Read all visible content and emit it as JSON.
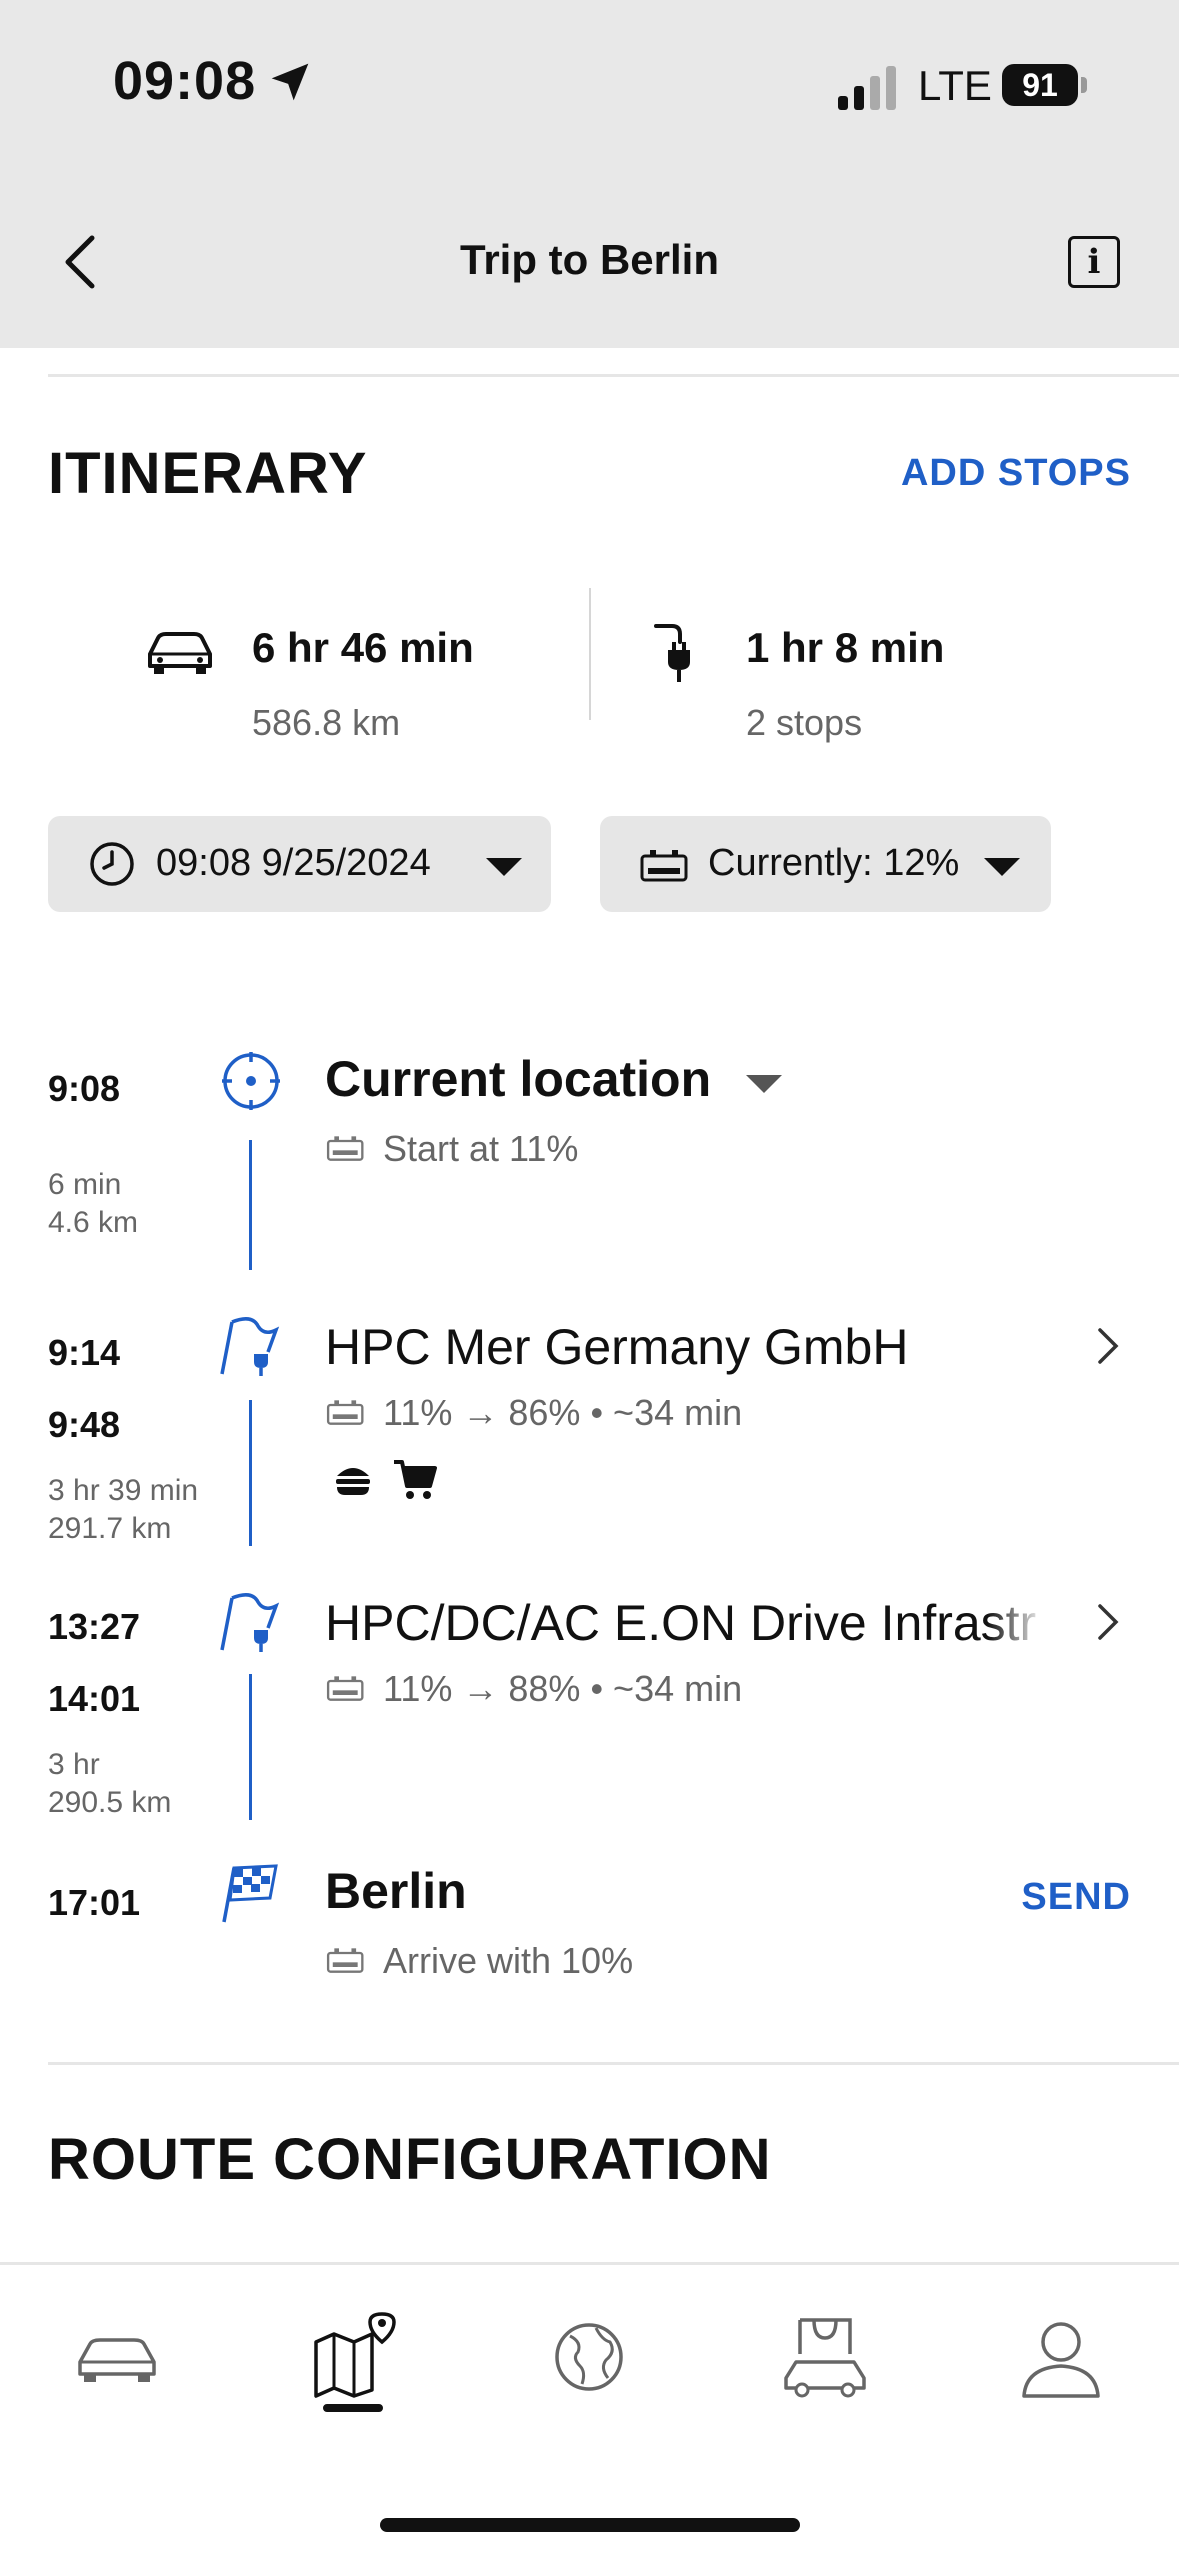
{
  "status_bar": {
    "time": "09:08",
    "carrier": "LTE",
    "battery": "91"
  },
  "nav": {
    "title": "Trip to Berlin"
  },
  "itinerary": {
    "title": "ITINERARY",
    "add_stops": "ADD STOPS",
    "drive": {
      "duration": "6 hr 46 min",
      "distance": "586.8 km"
    },
    "charging": {
      "duration": "1 hr 8 min",
      "stops": "2 stops"
    },
    "departure": "09:08 9/25/2024",
    "battery_now": "Currently: 12%"
  },
  "timeline": [
    {
      "time": "9:08",
      "name": "Current location",
      "sub": "Start at 11%",
      "leg_time": "6 min",
      "leg_dist": "4.6 km"
    },
    {
      "arrive": "9:14",
      "depart": "9:48",
      "name": "HPC Mer Germany GmbH",
      "sub": "11% → 86% • ~34 min",
      "leg_time": "3 hr 39 min",
      "leg_dist": "291.7 km"
    },
    {
      "arrive": "13:27",
      "depart": "14:01",
      "name": "HPC/DC/AC E.ON Drive Infrastr",
      "sub": "11% → 88% • ~34 min",
      "leg_time": "3 hr",
      "leg_dist": "290.5 km"
    },
    {
      "time": "17:01",
      "name": "Berlin",
      "sub": "Arrive with 10%",
      "send": "SEND"
    }
  ],
  "route_config": {
    "title": "ROUTE CONFIGURATION"
  },
  "colors": {
    "accent": "#1f5fc7",
    "header_bg": "#e8e8e8"
  },
  "tabs": [
    "car-icon",
    "map-pin-icon",
    "globe-icon",
    "shop-car-icon",
    "profile-icon"
  ]
}
